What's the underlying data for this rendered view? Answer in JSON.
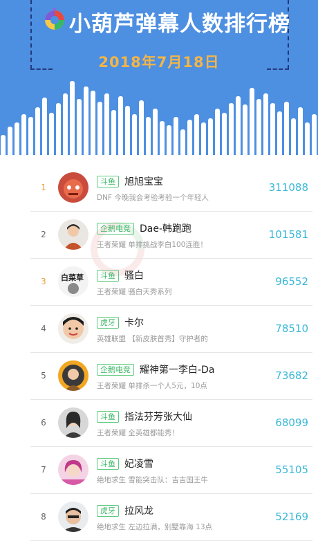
{
  "header": {
    "title": "小葫芦弹幕人数排行榜",
    "date": "2018年7月18日",
    "logo_icon": "huluzhu-logo-icon",
    "bg_color": "#4d8fe1",
    "date_color": "#f3b548"
  },
  "colors": {
    "tag_green": "#3bb765",
    "count_blue": "#39b8d8",
    "rank_gold": "#e6a23c"
  },
  "list": [
    {
      "rank": "1",
      "platform": "斗鱼",
      "name": "旭旭宝宝",
      "desc": "DNF 今晚我会考验考验一个年轻人",
      "count": "311088",
      "avatar_icon": "avatar-1"
    },
    {
      "rank": "2",
      "platform": "企鹅电竞",
      "name": "Dae-韩跑跑",
      "desc": "王者荣耀 单排挑战李白100连胜！",
      "count": "101581",
      "avatar_icon": "avatar-2"
    },
    {
      "rank": "3",
      "platform": "斗鱼",
      "name": "骚白",
      "desc": "王者荣耀 骚白天秀系列",
      "count": "96552",
      "avatar_icon": "avatar-3"
    },
    {
      "rank": "4",
      "platform": "虎牙",
      "name": "卡尔",
      "desc": "英雄联盟 【新皮肤首秀】守护者的",
      "count": "78510",
      "avatar_icon": "avatar-4"
    },
    {
      "rank": "5",
      "platform": "企鹅电竞",
      "name": "耀神第一李白-Da",
      "desc": "王者荣耀 单排杀一个人5元，10点",
      "count": "73682",
      "avatar_icon": "avatar-5"
    },
    {
      "rank": "6",
      "platform": "斗鱼",
      "name": "指法芬芳张大仙",
      "desc": "王者荣耀 全英雄都能秀！",
      "count": "68099",
      "avatar_icon": "avatar-6"
    },
    {
      "rank": "7",
      "platform": "斗鱼",
      "name": "妃凌雪",
      "desc": "绝地求生 雪能突击队：吉吉国王牛",
      "count": "55105",
      "avatar_icon": "avatar-7"
    },
    {
      "rank": "8",
      "platform": "虎牙",
      "name": "拉风龙",
      "desc": "绝地求生 左边拉满，别墅靠海 13点",
      "count": "52169",
      "avatar_icon": "avatar-8"
    }
  ],
  "watermark": {
    "text": "小葫芦",
    "subtext": "xiaohulu.com"
  }
}
